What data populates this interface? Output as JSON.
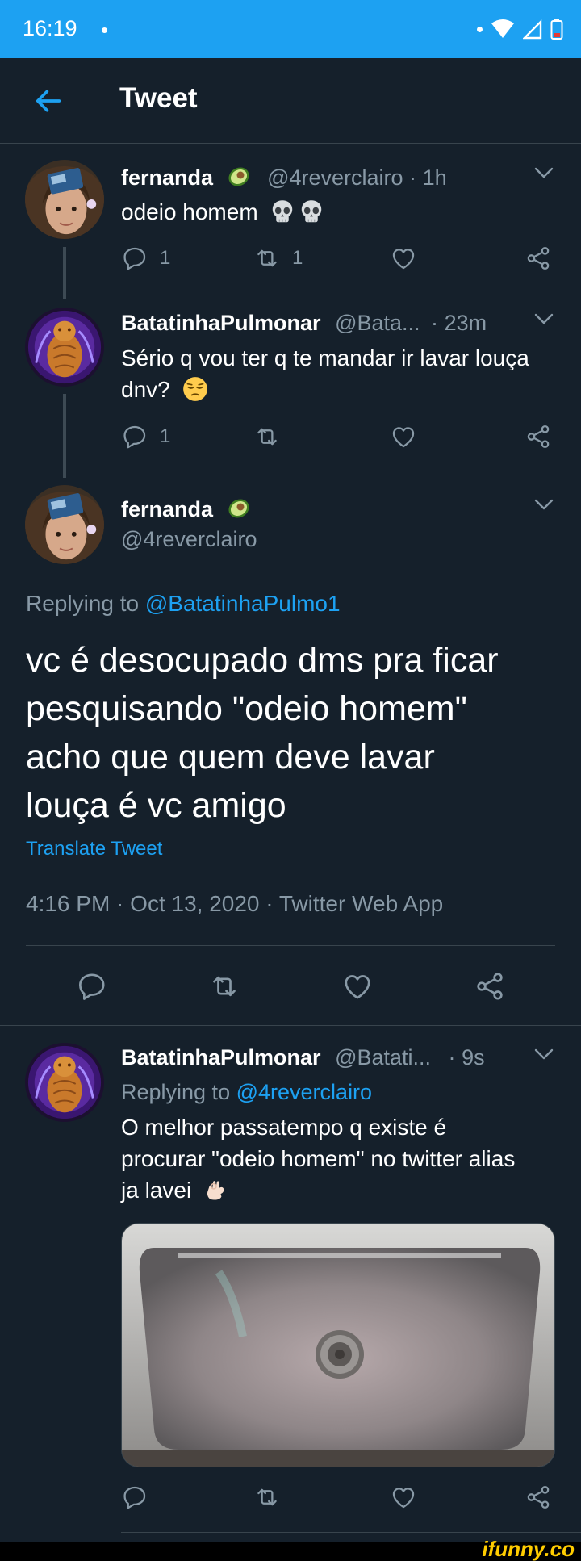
{
  "status_bar": {
    "time": "16:19"
  },
  "app_bar": {
    "title": "Tweet"
  },
  "tweet1": {
    "name": "fernanda",
    "handle": "@4reverclairo",
    "sep": "·",
    "time": "1h",
    "text": "odeio homem",
    "reply_count": "1",
    "retweet_count": "1"
  },
  "tweet2": {
    "name": "BatatinhaPulmonar",
    "handle": "@Bata...",
    "sep": "·",
    "time": "23m",
    "text_line1": "Sério q vou ter q te mandar ir lavar louça",
    "text_line2": "dnv?",
    "reply_count": "1"
  },
  "main_tweet": {
    "name": "fernanda",
    "handle": "@4reverclairo",
    "replying_label": "Replying to",
    "replying_handle": "@BatatinhaPulmo1",
    "text_line1": "vc é desocupado dms pra ficar",
    "text_line2": "pesquisando \"odeio homem\"",
    "text_line3": "acho que quem deve lavar",
    "text_line4": "louça é vc amigo",
    "translate": "Translate Tweet",
    "meta": "4:16 PM · Oct 13, 2020 · Twitter Web App"
  },
  "reply_tweet": {
    "name": "BatatinhaPulmonar",
    "handle": "@Batati...",
    "sep": "·",
    "time": "9s",
    "replying_label": "Replying to",
    "replying_handle": "@4reverclairo",
    "text_line1": "O melhor passatempo q existe é",
    "text_line2": "procurar \"odeio homem\" no twitter alias",
    "text_line3": "ja lavei"
  },
  "watermark": "ifunny.co",
  "icons": [
    "back-arrow-icon",
    "chevron-down-icon",
    "reply-icon",
    "retweet-icon",
    "like-icon",
    "share-icon",
    "wifi-icon",
    "signal-icon",
    "battery-icon",
    "avocado-emoji",
    "skull-emoji",
    "pensive-emoji",
    "ok-hand-emoji"
  ],
  "colors": {
    "accent": "#1da1f2",
    "background": "#15202b",
    "muted": "#8899a6",
    "divider": "#38444d"
  }
}
